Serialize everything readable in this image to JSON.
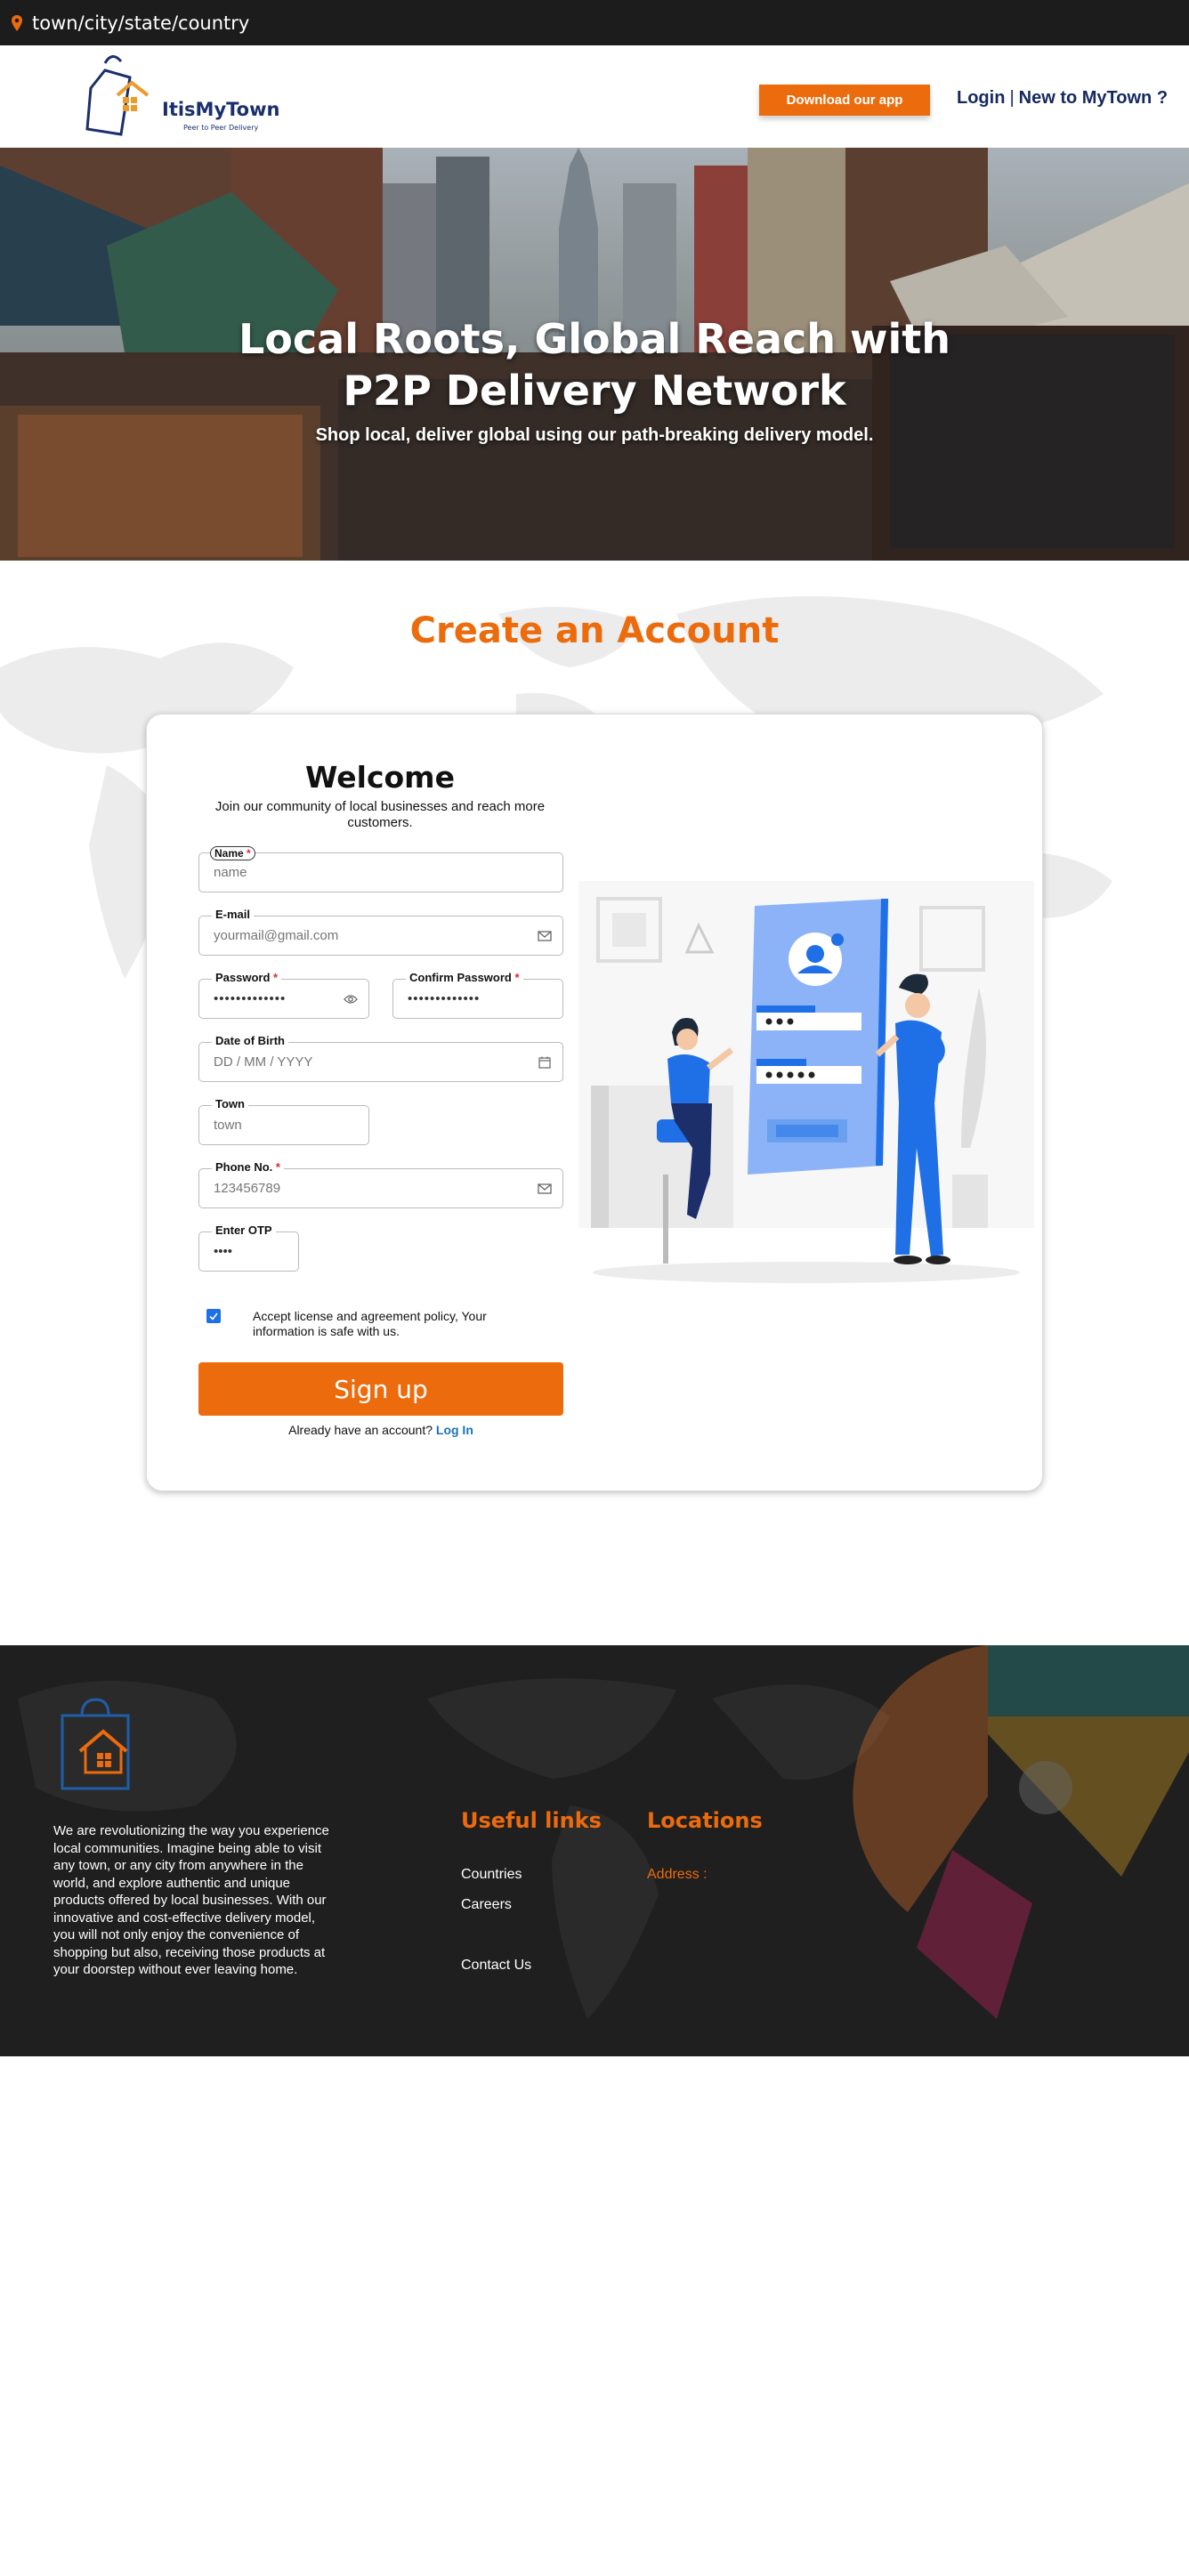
{
  "topbar": {
    "location": "town/city/state/country"
  },
  "header": {
    "logo_text": "ItisMyTown",
    "logo_tagline": "Peer to Peer Delivery",
    "download_label": "Download our app",
    "login_label": "Login",
    "separator": "|",
    "new_label": "New to MyTown ?"
  },
  "hero": {
    "title_line1": "Local Roots, Global Reach with",
    "title_line2": "P2P Delivery Network",
    "subtitle": "Shop local, deliver global using our path-breaking delivery model."
  },
  "form": {
    "section_title": "Create an Account",
    "welcome": "Welcome",
    "welcome_sub": "Join our community of local businesses and reach more customers.",
    "name_label": "Name",
    "name_placeholder": "name",
    "email_label": "E-mail",
    "email_placeholder": "yourmail@gmail.com",
    "password_label": "Password",
    "password_value": "•••••••••••••",
    "confirm_label": "Confirm Password",
    "confirm_value": "•••••••••••••",
    "dob_label": "Date of Birth",
    "dob_placeholder": "DD / MM / YYYY",
    "town_label": "Town",
    "town_placeholder": "town",
    "phone_label": "Phone No.",
    "phone_placeholder": "123456789",
    "otp_label": "Enter OTP",
    "otp_value": "••••",
    "required_mark": "*",
    "agree_text": "Accept license and agreement policy, Your information is safe with us.",
    "agree_checked": true,
    "signup_label": "Sign up",
    "have_account": "Already have an account?",
    "login_link": "Log In"
  },
  "footer": {
    "about": "We are revolutionizing the way you experience local communities. Imagine being able to visit any town, or any city from anywhere in the world, and explore authentic and unique products offered by local businesses. With our innovative and cost-effective delivery model, you will not only enjoy the convenience of shopping but also, receiving those products at your doorstep without ever leaving home.",
    "useful_links_title": "Useful links",
    "links": [
      "Countries",
      "Careers",
      "Contact Us"
    ],
    "locations_title": "Locations",
    "address_label": "Address :"
  },
  "colors": {
    "accent": "#ec6b0c",
    "navy": "#15295e",
    "link": "#1a73b8",
    "footer_bg": "#1f1f1f",
    "check": "#1f6fe6"
  },
  "icons": [
    "map-pin-icon",
    "mail-icon",
    "eye-icon",
    "calendar-icon",
    "check-icon",
    "bag-logo-icon"
  ]
}
